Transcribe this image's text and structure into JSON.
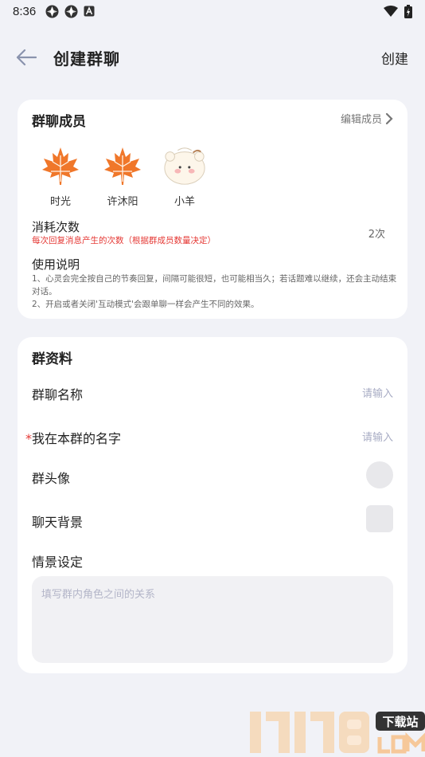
{
  "status_bar": {
    "time": "8:36"
  },
  "header": {
    "title": "创建群聊",
    "create_label": "创建"
  },
  "members_card": {
    "title": "群聊成员",
    "edit_label": "编辑成员",
    "members": [
      {
        "name": "时光",
        "icon": "maple-leaf-icon"
      },
      {
        "name": "许沐阳",
        "icon": "maple-leaf-icon"
      },
      {
        "name": "小羊",
        "icon": "sheep-avatar-icon"
      }
    ],
    "consume_label": "消耗次数",
    "consume_note": "每次回复消息产生的次数（根据群成员数量决定）",
    "consume_count": "2次",
    "usage_label": "使用说明",
    "usage_text": "1、心灵会完全按自己的节奏回复，间隔可能很短，也可能相当久；若话题难以继续，还会主动结束对话。\n2、开启或者关闭'互动模式'会跟单聊一样会产生不同的效果。"
  },
  "profile_card": {
    "title": "群资料",
    "group_name_label": "群聊名称",
    "group_name_placeholder": "请输入",
    "my_name_star": "*",
    "my_name_label": "我在本群的名字",
    "my_name_placeholder": "请输入",
    "group_avatar_label": "群头像",
    "chat_bg_label": "聊天背景",
    "scene_label": "情景设定",
    "scene_placeholder": "填写群内角色之间的关系"
  },
  "colors": {
    "background": "#f1f2f7",
    "card": "#ffffff",
    "warning": "#e53935",
    "placeholder": "#a8acc4",
    "leaf_orange": "#f0772a"
  }
}
